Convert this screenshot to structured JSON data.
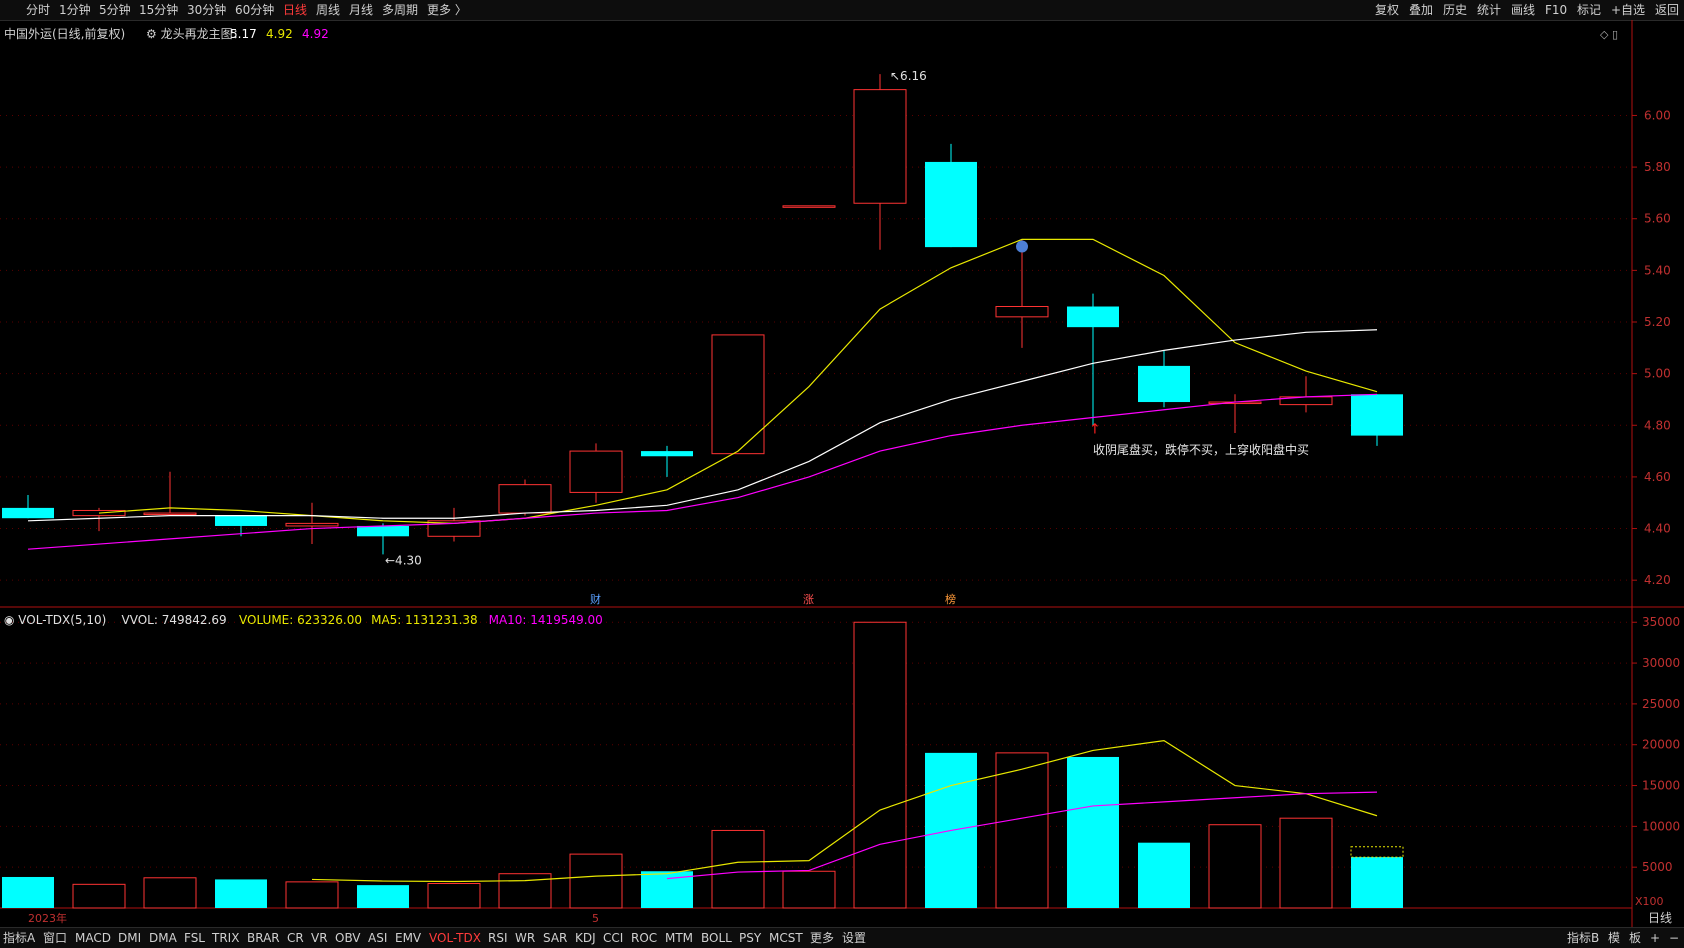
{
  "top_toolbar": {
    "left_items": [
      "分时",
      "1分钟",
      "5分钟",
      "15分钟",
      "30分钟",
      "60分钟",
      "日线",
      "周线",
      "月线",
      "多周期",
      "更多 〉"
    ],
    "active": "日线",
    "right_items": [
      "复权",
      "叠加",
      "历史",
      "统计",
      "画线",
      "F10",
      "标记",
      "+自选",
      "返回"
    ]
  },
  "bottom_toolbar": {
    "left_items": [
      "指标A",
      "窗口",
      "MACD",
      "DMI",
      "DMA",
      "FSL",
      "TRIX",
      "BRAR",
      "CR",
      "VR",
      "OBV",
      "ASI",
      "EMV",
      "VOL-TDX",
      "RSI",
      "WR",
      "SAR",
      "KDJ",
      "CCI",
      "ROC",
      "MTM",
      "BOLL",
      "PSY",
      "MCST",
      "更多",
      "设置"
    ],
    "active": "VOL-TDX",
    "right_items": [
      "指标B",
      "模",
      "板",
      "+",
      "−"
    ]
  },
  "main_panel": {
    "title_stock": "中国外运(日线,前复权)",
    "title_indicator": "龙头再龙主图：",
    "values": [
      "5.17",
      "4.92",
      "4.92"
    ],
    "annotation": "收阴尾盘买，跌停不买，上穿收阳盘中买",
    "high_label": "6.16",
    "low_label": "4.30",
    "markers": [
      "财",
      "涨",
      "榜"
    ]
  },
  "volume_panel": {
    "title": "VOL-TDX(5,10)",
    "vvol": "VVOL: 749842.69",
    "volume": "VOLUME: 623326.00",
    "ma5": "MA5: 1131231.38",
    "ma10": "MA10: 1419549.00",
    "unit": "X100"
  },
  "x_axis": {
    "year_label": "2023年",
    "month_label": "5",
    "period_label": "日线"
  },
  "colors": {
    "up": "#ff3333",
    "down": "#00ffff",
    "ma5": "#e8e800",
    "ma10": "#ffffff",
    "ma20": "#ff00ff",
    "axis": "#b01010",
    "grid": "#5a0000",
    "text": "#c8c8c8"
  },
  "chart_data": [
    {
      "type": "candlestick",
      "title": "中国外运(日线,前复权)",
      "ylim": [
        4.1,
        6.3
      ],
      "y_ticks": [
        4.2,
        4.4,
        4.6,
        4.8,
        5.0,
        5.2,
        5.4,
        5.6,
        5.8,
        6.0
      ],
      "candles": [
        {
          "o": 4.48,
          "h": 4.53,
          "l": 4.44,
          "c": 4.44
        },
        {
          "o": 4.45,
          "h": 4.48,
          "l": 4.39,
          "c": 4.47
        },
        {
          "o": 4.46,
          "h": 4.62,
          "l": 4.45,
          "c": 4.46
        },
        {
          "o": 4.45,
          "h": 4.45,
          "l": 4.37,
          "c": 4.41
        },
        {
          "o": 4.41,
          "h": 4.5,
          "l": 4.34,
          "c": 4.42
        },
        {
          "o": 4.41,
          "h": 4.42,
          "l": 4.3,
          "c": 4.37
        },
        {
          "o": 4.37,
          "h": 4.48,
          "l": 4.35,
          "c": 4.43
        },
        {
          "o": 4.46,
          "h": 4.59,
          "l": 4.45,
          "c": 4.57
        },
        {
          "o": 4.54,
          "h": 4.73,
          "l": 4.5,
          "c": 4.7
        },
        {
          "o": 4.7,
          "h": 4.72,
          "l": 4.6,
          "c": 4.68
        },
        {
          "o": 4.69,
          "h": 5.15,
          "l": 4.69,
          "c": 5.15
        },
        {
          "o": 5.65,
          "h": 5.65,
          "l": 5.65,
          "c": 5.65
        },
        {
          "o": 5.66,
          "h": 6.16,
          "l": 5.48,
          "c": 6.1
        },
        {
          "o": 5.82,
          "h": 5.89,
          "l": 5.49,
          "c": 5.49
        },
        {
          "o": 5.22,
          "h": 5.52,
          "l": 5.1,
          "c": 5.26
        },
        {
          "o": 5.26,
          "h": 5.31,
          "l": 4.8,
          "c": 5.18
        },
        {
          "o": 5.03,
          "h": 5.09,
          "l": 4.87,
          "c": 4.89
        },
        {
          "o": 4.89,
          "h": 4.92,
          "l": 4.77,
          "c": 4.89
        },
        {
          "o": 4.88,
          "h": 4.99,
          "l": 4.85,
          "c": 4.91
        },
        {
          "o": 4.92,
          "h": 4.92,
          "l": 4.72,
          "c": 4.76
        }
      ],
      "series": [
        {
          "name": "5.17",
          "values": [
            null,
            4.46,
            4.48,
            4.47,
            4.45,
            4.43,
            4.42,
            4.44,
            4.49,
            4.55,
            4.7,
            4.95,
            5.25,
            5.41,
            5.52,
            5.52,
            5.38,
            5.12,
            5.01,
            4.93
          ]
        },
        {
          "name": "4.92",
          "values": [
            4.43,
            4.44,
            4.45,
            4.45,
            4.45,
            4.44,
            4.44,
            4.46,
            4.47,
            4.49,
            4.55,
            4.66,
            4.81,
            4.9,
            4.97,
            5.04,
            5.09,
            5.13,
            5.16,
            5.17
          ]
        },
        {
          "name": "4.92",
          "values": [
            4.32,
            4.34,
            4.36,
            4.38,
            4.4,
            4.41,
            4.42,
            4.44,
            4.46,
            4.47,
            4.52,
            4.6,
            4.7,
            4.76,
            4.8,
            4.83,
            4.86,
            4.89,
            4.91,
            4.92
          ]
        }
      ]
    },
    {
      "type": "bar",
      "title": "VOL-TDX(5,10)",
      "unit": "X100",
      "ylim": [
        0,
        36500
      ],
      "y_ticks": [
        5000,
        10000,
        15000,
        20000,
        25000,
        30000,
        35000
      ],
      "values": [
        3800,
        2900,
        3700,
        3500,
        3200,
        2800,
        3000,
        4200,
        6600,
        4500,
        9500,
        4500,
        35000,
        19000,
        19000,
        18500,
        8000,
        10200,
        11000,
        6233
      ],
      "ma5": [
        null,
        null,
        null,
        null,
        3500,
        3300,
        3250,
        3350,
        3900,
        4200,
        5600,
        5800,
        12000,
        15000,
        17000,
        19300,
        20500,
        15000,
        14000,
        11300
      ],
      "ma10": [
        null,
        null,
        null,
        null,
        null,
        null,
        null,
        null,
        null,
        3600,
        4400,
        4600,
        7800,
        9500,
        11000,
        12500,
        13000,
        13500,
        14000,
        14195
      ],
      "avg_line": [
        null,
        null,
        null,
        null,
        null,
        null,
        null,
        null,
        null,
        null,
        null,
        null,
        null,
        null,
        null,
        null,
        null,
        null,
        null,
        7498
      ]
    }
  ]
}
